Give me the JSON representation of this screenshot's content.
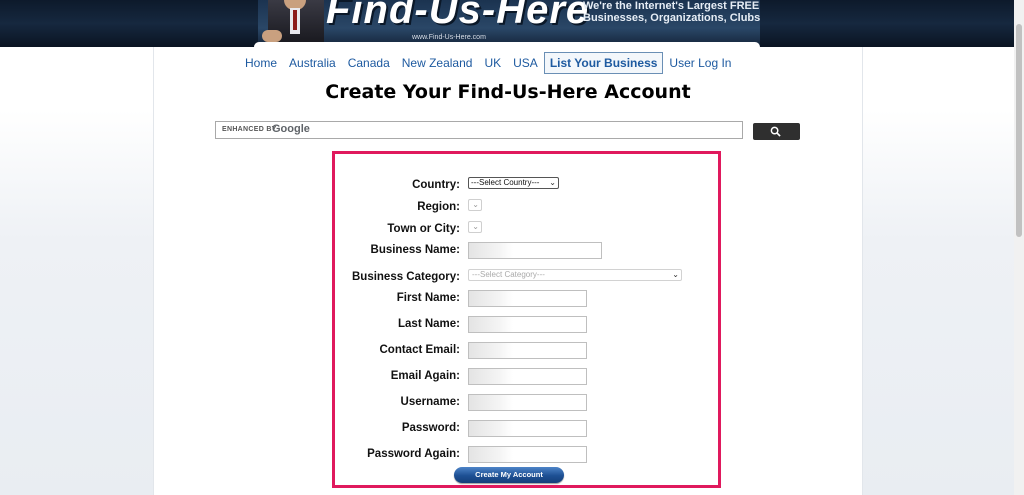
{
  "header": {
    "logo_text": "Find-Us-Here",
    "logo_url_text": "www.Find-Us-Here.com",
    "tagline_line1": "We're the Internet's Largest FREE G",
    "tagline_line2": "Businesses, Organizations, Clubs a"
  },
  "nav": {
    "items": [
      {
        "label": "Home"
      },
      {
        "label": "Australia"
      },
      {
        "label": "Canada"
      },
      {
        "label": "New Zealand"
      },
      {
        "label": "UK"
      },
      {
        "label": "USA"
      },
      {
        "label": "List Your Business"
      },
      {
        "label": "User Log In"
      }
    ],
    "active": "List Your Business"
  },
  "page_title": "Create Your Find-Us-Here Account",
  "search": {
    "enhanced_by": "ENHANCED BY",
    "google": "Google",
    "button_icon": "search-icon"
  },
  "form": {
    "country_label": "Country:",
    "country_value": "---Select Country---",
    "region_label": "Region:",
    "town_label": "Town or City:",
    "business_name_label": "Business Name:",
    "business_category_label": "Business Category:",
    "business_category_value": "---Select Category---",
    "first_name_label": "First Name:",
    "last_name_label": "Last Name:",
    "contact_email_label": "Contact Email:",
    "email_again_label": "Email Again:",
    "username_label": "Username:",
    "password_label": "Password:",
    "password_again_label": "Password Again:",
    "submit_label": "Create My Account"
  },
  "colors": {
    "form_border": "#e0195d",
    "nav_link": "#1e5aa0",
    "banner_bg": "#16283f",
    "submit_bg": "#1d4f93"
  }
}
